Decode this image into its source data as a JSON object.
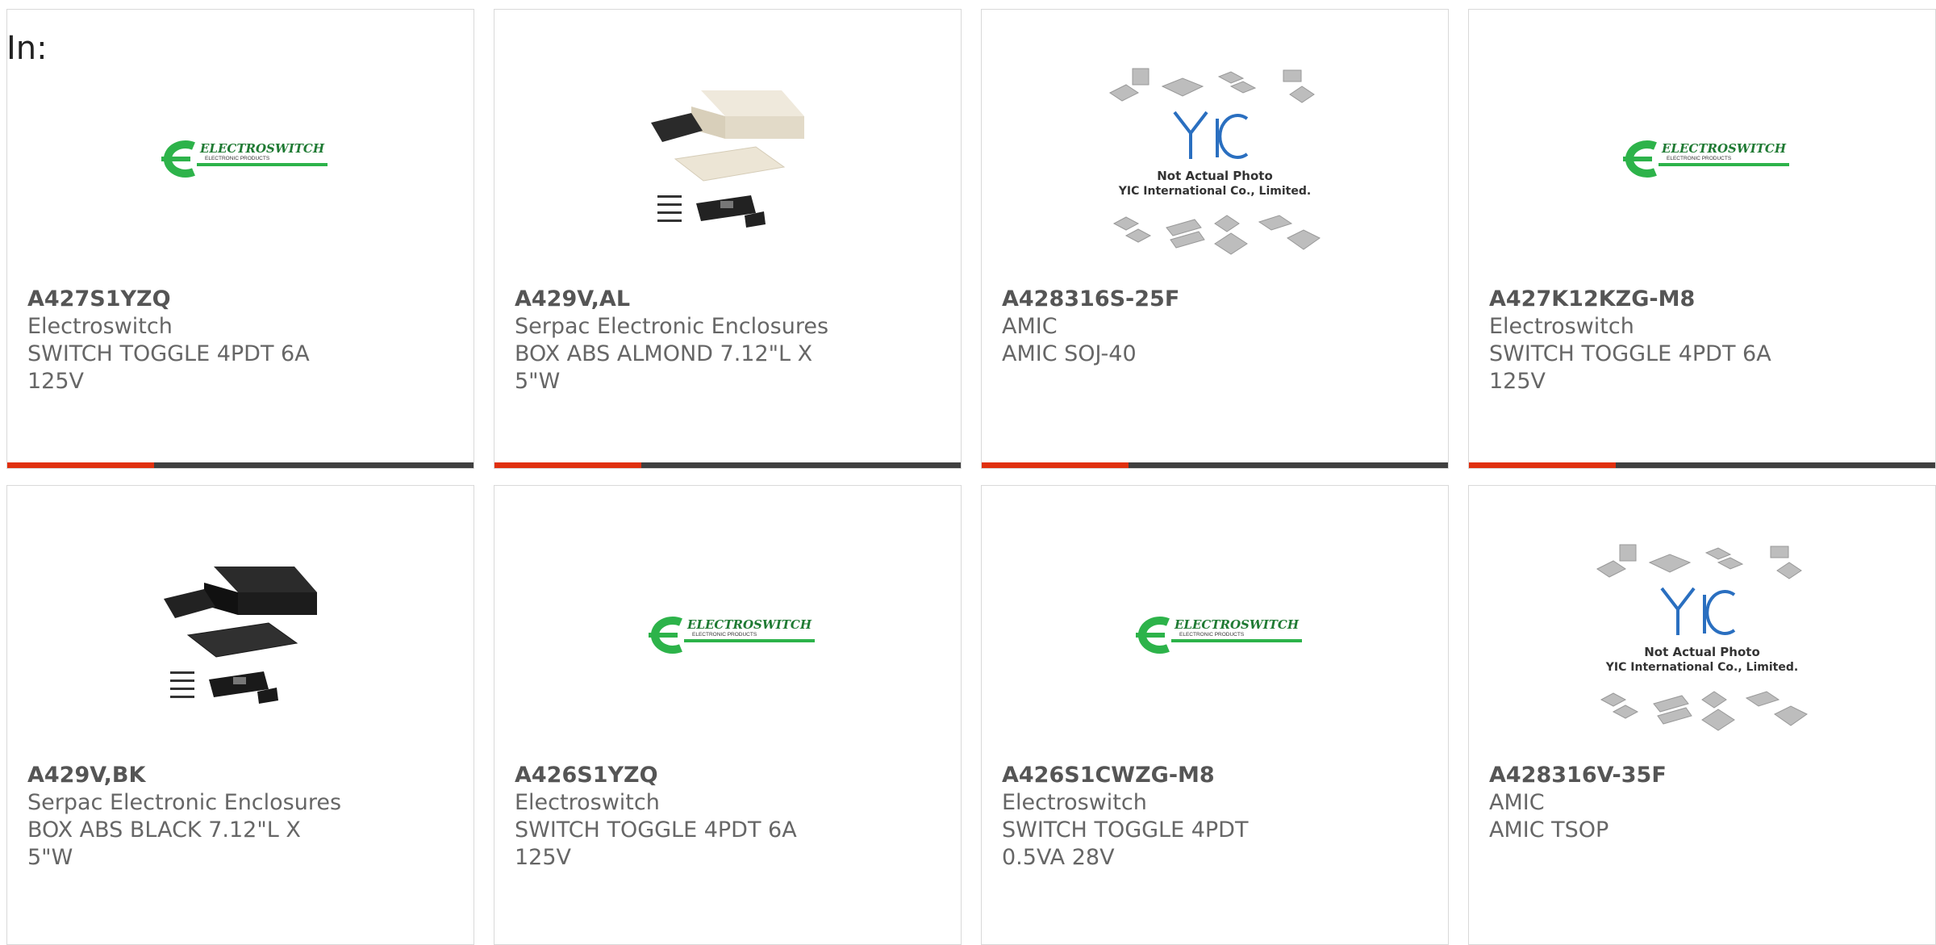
{
  "header": {
    "in_label": "In:"
  },
  "colors": {
    "accent": "#e0300e",
    "bar": "#3f3f3f",
    "logo_green": "#2db34a"
  },
  "products": [
    {
      "part": "A427S1YZQ",
      "maker": "Electroswitch",
      "desc": "SWITCH TOGGLE 4PDT 6A 125V",
      "image": "electroswitch-logo",
      "logo_text": "ELECTROSWITCH",
      "logo_sub": "ELECTRONIC PRODUCTS"
    },
    {
      "part": "A429V,AL",
      "maker": "Serpac Electronic Enclosures",
      "desc": "BOX ABS ALMOND 7.12\"L X 5\"W",
      "image": "enclosure-almond"
    },
    {
      "part": "A428316S-25F",
      "maker": "AMIC",
      "desc": "AMIC SOJ-40",
      "image": "yic-placeholder",
      "ph_line1": "Not Actual Photo",
      "ph_line2": "YIC International Co., Limited."
    },
    {
      "part": "A427K12KZG-M8",
      "maker": "Electroswitch",
      "desc": "SWITCH TOGGLE 4PDT 6A 125V",
      "image": "electroswitch-logo",
      "logo_text": "ELECTROSWITCH",
      "logo_sub": "ELECTRONIC PRODUCTS"
    },
    {
      "part": "A429V,BK",
      "maker": "Serpac Electronic Enclosures",
      "desc": "BOX ABS BLACK 7.12\"L X 5\"W",
      "image": "enclosure-black"
    },
    {
      "part": "A426S1YZQ",
      "maker": "Electroswitch",
      "desc": "SWITCH TOGGLE 4PDT 6A 125V",
      "image": "electroswitch-logo",
      "logo_text": "ELECTROSWITCH",
      "logo_sub": "ELECTRONIC PRODUCTS"
    },
    {
      "part": "A426S1CWZG-M8",
      "maker": "Electroswitch",
      "desc": "SWITCH TOGGLE 4PDT 0.5VA 28V",
      "image": "electroswitch-logo",
      "logo_text": "ELECTROSWITCH",
      "logo_sub": "ELECTRONIC PRODUCTS"
    },
    {
      "part": "A428316V-35F",
      "maker": "AMIC",
      "desc": "AMIC TSOP",
      "image": "yic-placeholder",
      "ph_line1": "Not Actual Photo",
      "ph_line2": "YIC International Co., Limited."
    }
  ]
}
